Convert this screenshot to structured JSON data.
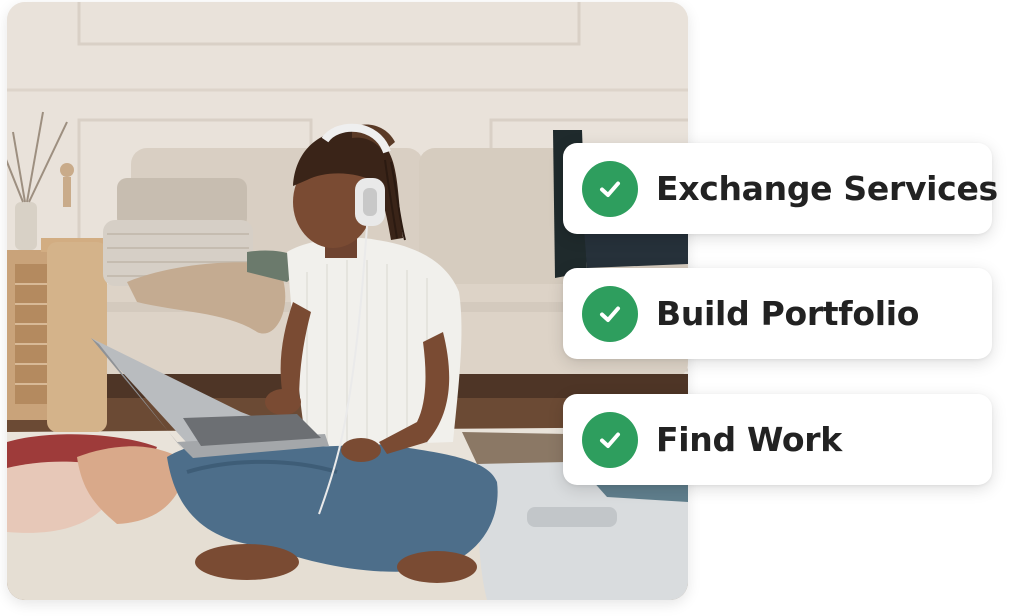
{
  "features": [
    {
      "label": "Exchange Services",
      "icon": "check-circle-icon"
    },
    {
      "label": "Build Portfolio",
      "icon": "check-circle-icon"
    },
    {
      "label": "Find Work",
      "icon": "check-circle-icon"
    }
  ],
  "colors": {
    "check_green": "#2e9e5e",
    "text": "#222222",
    "card_bg": "#ffffff"
  }
}
